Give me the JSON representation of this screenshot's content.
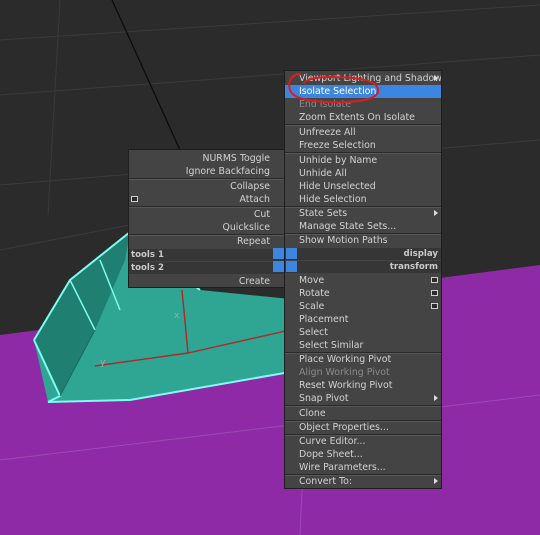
{
  "colors": {
    "viewport_dark": "#2b2b2b",
    "ground_purple": "#8e2aa5",
    "object_teal": "#2fa593",
    "selection_outline": "#7ffcf0",
    "menu_bg": "#444444",
    "highlight": "#3d86df",
    "annotation_red": "#e01b1b"
  },
  "quad_left": {
    "items": [
      {
        "label": "NURMS Toggle"
      },
      {
        "label": "Ignore Backfacing"
      },
      {
        "label": "Collapse"
      },
      {
        "label": "Attach",
        "icon": "settings-box-icon"
      },
      {
        "label": "Cut"
      },
      {
        "label": "Quickslice"
      },
      {
        "label": "Repeat"
      }
    ],
    "tools1_label": "tools 1",
    "tools2_label": "tools 2",
    "create_label": "Create"
  },
  "quad_right": {
    "display_label": "display",
    "transform_label": "transform",
    "display_items": [
      {
        "label": "Viewport Lighting and Shadows",
        "submenu": true
      },
      {
        "label": "Isolate Selection",
        "highlighted": true
      },
      {
        "label": "End Isolate",
        "disabled": true
      },
      {
        "label": "Zoom Extents On Isolate"
      },
      {
        "label": "Unfreeze All"
      },
      {
        "label": "Freeze Selection"
      },
      {
        "label": "Unhide by Name"
      },
      {
        "label": "Unhide All"
      },
      {
        "label": "Hide Unselected"
      },
      {
        "label": "Hide Selection"
      },
      {
        "label": "State Sets",
        "submenu": true
      },
      {
        "label": "Manage State Sets..."
      },
      {
        "label": "Show Motion Paths"
      }
    ],
    "transform_items": [
      {
        "label": "Move",
        "icon": "settings-box-icon"
      },
      {
        "label": "Rotate",
        "icon": "settings-box-icon"
      },
      {
        "label": "Scale",
        "icon": "settings-box-icon"
      },
      {
        "label": "Placement"
      },
      {
        "label": "Select"
      },
      {
        "label": "Select Similar"
      },
      {
        "label": "Place Working Pivot"
      },
      {
        "label": "Align Working Pivot",
        "disabled": true
      },
      {
        "label": "Reset Working Pivot"
      },
      {
        "label": "Snap Pivot",
        "submenu": true
      },
      {
        "label": "Clone"
      },
      {
        "label": "Object Properties..."
      },
      {
        "label": "Curve Editor..."
      },
      {
        "label": "Dope Sheet..."
      },
      {
        "label": "Wire Parameters..."
      },
      {
        "label": "Convert To:",
        "submenu": true
      }
    ]
  },
  "gizmo": {
    "x_label": "x",
    "y_label": "y"
  }
}
